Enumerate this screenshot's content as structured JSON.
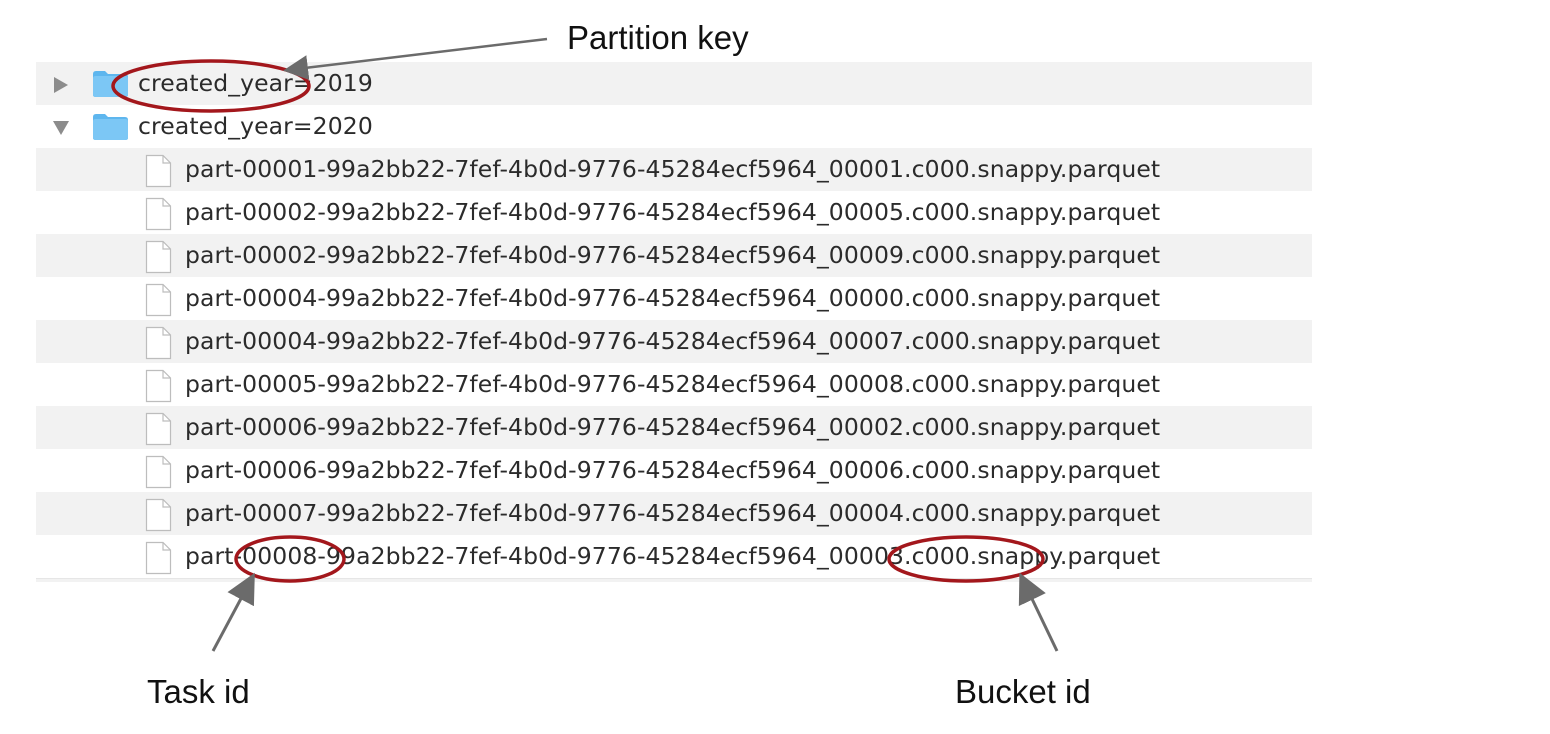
{
  "callouts": {
    "partition_key": "Partition key",
    "task_id": "Task id",
    "bucket_id": "Bucket id"
  },
  "tree": {
    "folders": [
      {
        "name": "created_year=2019",
        "state": "collapsed",
        "disclosure_icon": "disclosure-triangle-right"
      },
      {
        "name": "created_year=2020",
        "state": "expanded",
        "disclosure_icon": "disclosure-triangle-down"
      }
    ],
    "files": [
      "part-00001-99a2bb22-7fef-4b0d-9776-45284ecf5964_00001.c000.snappy.parquet",
      "part-00002-99a2bb22-7fef-4b0d-9776-45284ecf5964_00005.c000.snappy.parquet",
      "part-00002-99a2bb22-7fef-4b0d-9776-45284ecf5964_00009.c000.snappy.parquet",
      "part-00004-99a2bb22-7fef-4b0d-9776-45284ecf5964_00000.c000.snappy.parquet",
      "part-00004-99a2bb22-7fef-4b0d-9776-45284ecf5964_00007.c000.snappy.parquet",
      "part-00005-99a2bb22-7fef-4b0d-9776-45284ecf5964_00008.c000.snappy.parquet",
      "part-00006-99a2bb22-7fef-4b0d-9776-45284ecf5964_00002.c000.snappy.parquet",
      "part-00006-99a2bb22-7fef-4b0d-9776-45284ecf5964_00006.c000.snappy.parquet",
      "part-00007-99a2bb22-7fef-4b0d-9776-45284ecf5964_00004.c000.snappy.parquet",
      "part-00008-99a2bb22-7fef-4b0d-9776-45284ecf5964_00003.c000.snappy.parquet"
    ]
  },
  "colors": {
    "row_stripe": "#f2f2f2",
    "annotation_ellipse": "#a3171c",
    "annotation_arrow": "#6b6b6b",
    "folder_blue": "#7cc7f5",
    "folder_tab": "#5eb6ee"
  }
}
